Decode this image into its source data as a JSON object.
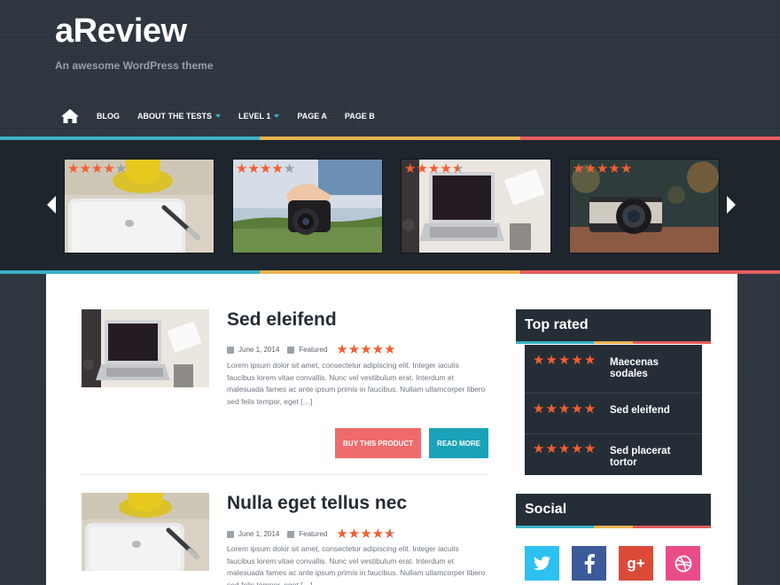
{
  "site": {
    "title": "aReview",
    "tagline": "An awesome WordPress theme"
  },
  "nav": {
    "home_icon": "home-icon",
    "items": [
      {
        "label": "BLOG",
        "has_dropdown": false
      },
      {
        "label": "ABOUT THE TESTS",
        "has_dropdown": true
      },
      {
        "label": "LEVEL 1",
        "has_dropdown": true
      },
      {
        "label": "PAGE A",
        "has_dropdown": false
      },
      {
        "label": "PAGE B",
        "has_dropdown": false
      }
    ]
  },
  "slider": {
    "slides": [
      {
        "image": "coffee-cup-and-tablet",
        "rating": 4
      },
      {
        "image": "hand-holding-camera",
        "rating": 4
      },
      {
        "image": "laptop-on-desk",
        "rating": 4.5
      },
      {
        "image": "vintage-camera",
        "rating": 5
      }
    ],
    "prev_icon": "chevron-left-icon",
    "next_icon": "chevron-right-icon"
  },
  "posts": [
    {
      "title": "Sed eleifend",
      "date": "June 1, 2014",
      "category": "Featured",
      "rating": 5,
      "excerpt": "Lorem ipsum dolor sit amet, consectetur adipiscing elit. Integer iaculis faucibus lorem vitae convallis. Nunc vel vestibulum erat. Interdum et malesuada fames ac ante ipsum primis in faucibus. Nullam ullamcorper libero sed felis tempor, eget […]",
      "buy_label": "BUY THIS PRODUCT",
      "more_label": "READ MORE",
      "image": "laptop-on-desk"
    },
    {
      "title": "Nulla eget tellus nec",
      "date": "June 1, 2014",
      "category": "Featured",
      "rating": 4.5,
      "excerpt": "Lorem ipsum dolor sit amet, consectetur adipiscing elit. Integer iaculis faucibus lorem vitae convallis. Nunc vel vestibulum erat. Interdum et malesuada fames ac ante ipsum primis in faucibus. Nullam ullamcorper libero sed felis tempor, eget […]",
      "image": "coffee-cup-and-tablet"
    }
  ],
  "sidebar": {
    "top_rated": {
      "title": "Top rated",
      "items": [
        {
          "label": "Maecenas sodales",
          "rating": 5
        },
        {
          "label": "Sed eleifend",
          "rating": 5
        },
        {
          "label": "Sed placerat tortor",
          "rating": 5
        }
      ]
    },
    "social": {
      "title": "Social",
      "buttons": [
        {
          "network": "twitter",
          "icon": "twitter-icon",
          "glyph": "t",
          "color": "#2dc1f2"
        },
        {
          "network": "facebook",
          "icon": "facebook-icon",
          "glyph": "f",
          "color": "#3c5a99"
        },
        {
          "network": "google-plus",
          "icon": "google-plus-icon",
          "glyph": "g+",
          "color": "#dc4a38"
        },
        {
          "network": "dribbble",
          "icon": "dribbble-icon",
          "glyph": "◎",
          "color": "#ea4c89"
        }
      ]
    }
  },
  "colors": {
    "accent_teal": "#1aa2b8",
    "accent_red": "#f06b6b",
    "star": "#f35d31",
    "dark": "#252e37"
  }
}
